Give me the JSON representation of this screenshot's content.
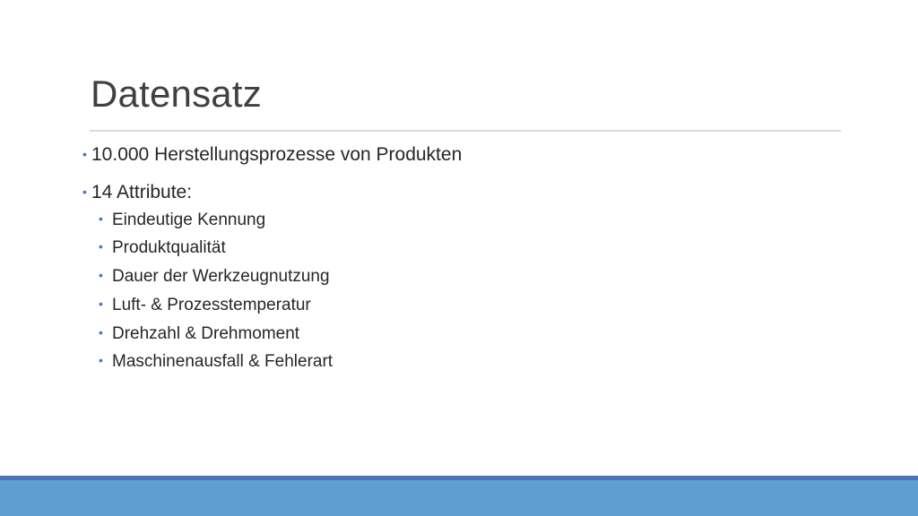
{
  "slide": {
    "title": "Datensatz",
    "bullets": [
      {
        "text": "10.000 Herstellungsprozesse von Produkten"
      },
      {
        "text": "14 Attribute:"
      }
    ],
    "sub_bullets": [
      {
        "text": "Eindeutige Kennung"
      },
      {
        "text": "Produktqualität"
      },
      {
        "text": "Dauer der Werkzeugnutzung"
      },
      {
        "text": "Luft- & Prozesstemperatur"
      },
      {
        "text": "Drehzahl & Drehmoment"
      },
      {
        "text": "Maschinenausfall & Fehlerart"
      }
    ],
    "bullet_glyph": "•"
  },
  "colors": {
    "title_text": "#404040",
    "body_text": "#262626",
    "bullet_accent": "#4472c4",
    "footer_band": "#5f9ed1",
    "footer_line": "#4a73b8",
    "title_rule": "#d9d9d9"
  }
}
